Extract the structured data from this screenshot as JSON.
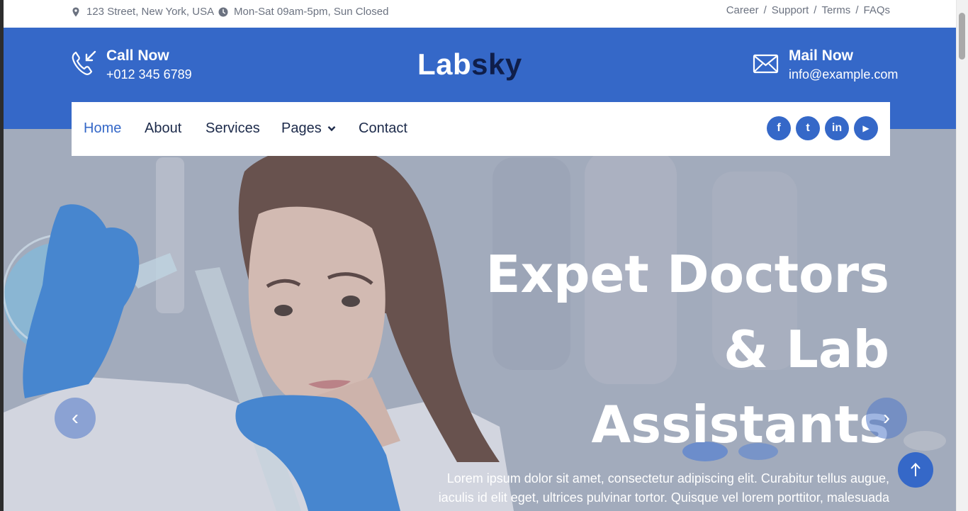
{
  "topbar": {
    "address": "123 Street, New York, USA",
    "hours": "Mon-Sat 09am-5pm, Sun Closed",
    "links": [
      "Career",
      "Support",
      "Terms",
      "FAQs"
    ],
    "separator": "/",
    "location_icon": "map-pin-icon",
    "clock_icon": "clock-icon"
  },
  "header": {
    "call": {
      "title": "Call Now",
      "value": "+012 345 6789",
      "icon": "phone-icon"
    },
    "mail": {
      "title": "Mail Now",
      "value": "info@example.com",
      "icon": "envelope-icon"
    },
    "logo": {
      "part1": "Lab",
      "part2": "sky"
    },
    "colors": {
      "primary": "#3568c8",
      "dark": "#0f1e4a"
    }
  },
  "nav": {
    "items": [
      "Home",
      "About",
      "Services",
      "Pages",
      "Contact"
    ],
    "active": "Home",
    "social": [
      {
        "name": "facebook",
        "glyph": "f"
      },
      {
        "name": "twitter",
        "glyph": "t"
      },
      {
        "name": "linkedin",
        "glyph": "in"
      },
      {
        "name": "youtube",
        "glyph": "▶"
      }
    ]
  },
  "hero": {
    "title_lines": [
      "Expet Doctors",
      "& Lab",
      "Assistants"
    ],
    "text": "Lorem ipsum dolor sit amet, consectetur adipiscing elit. Curabitur tellus augue, iaculis id elit eget, ultrices pulvinar tortor. Quisque vel lorem porttitor, malesuada arcu quis, fringilla",
    "prev_glyph": "‹",
    "next_glyph": "›"
  }
}
